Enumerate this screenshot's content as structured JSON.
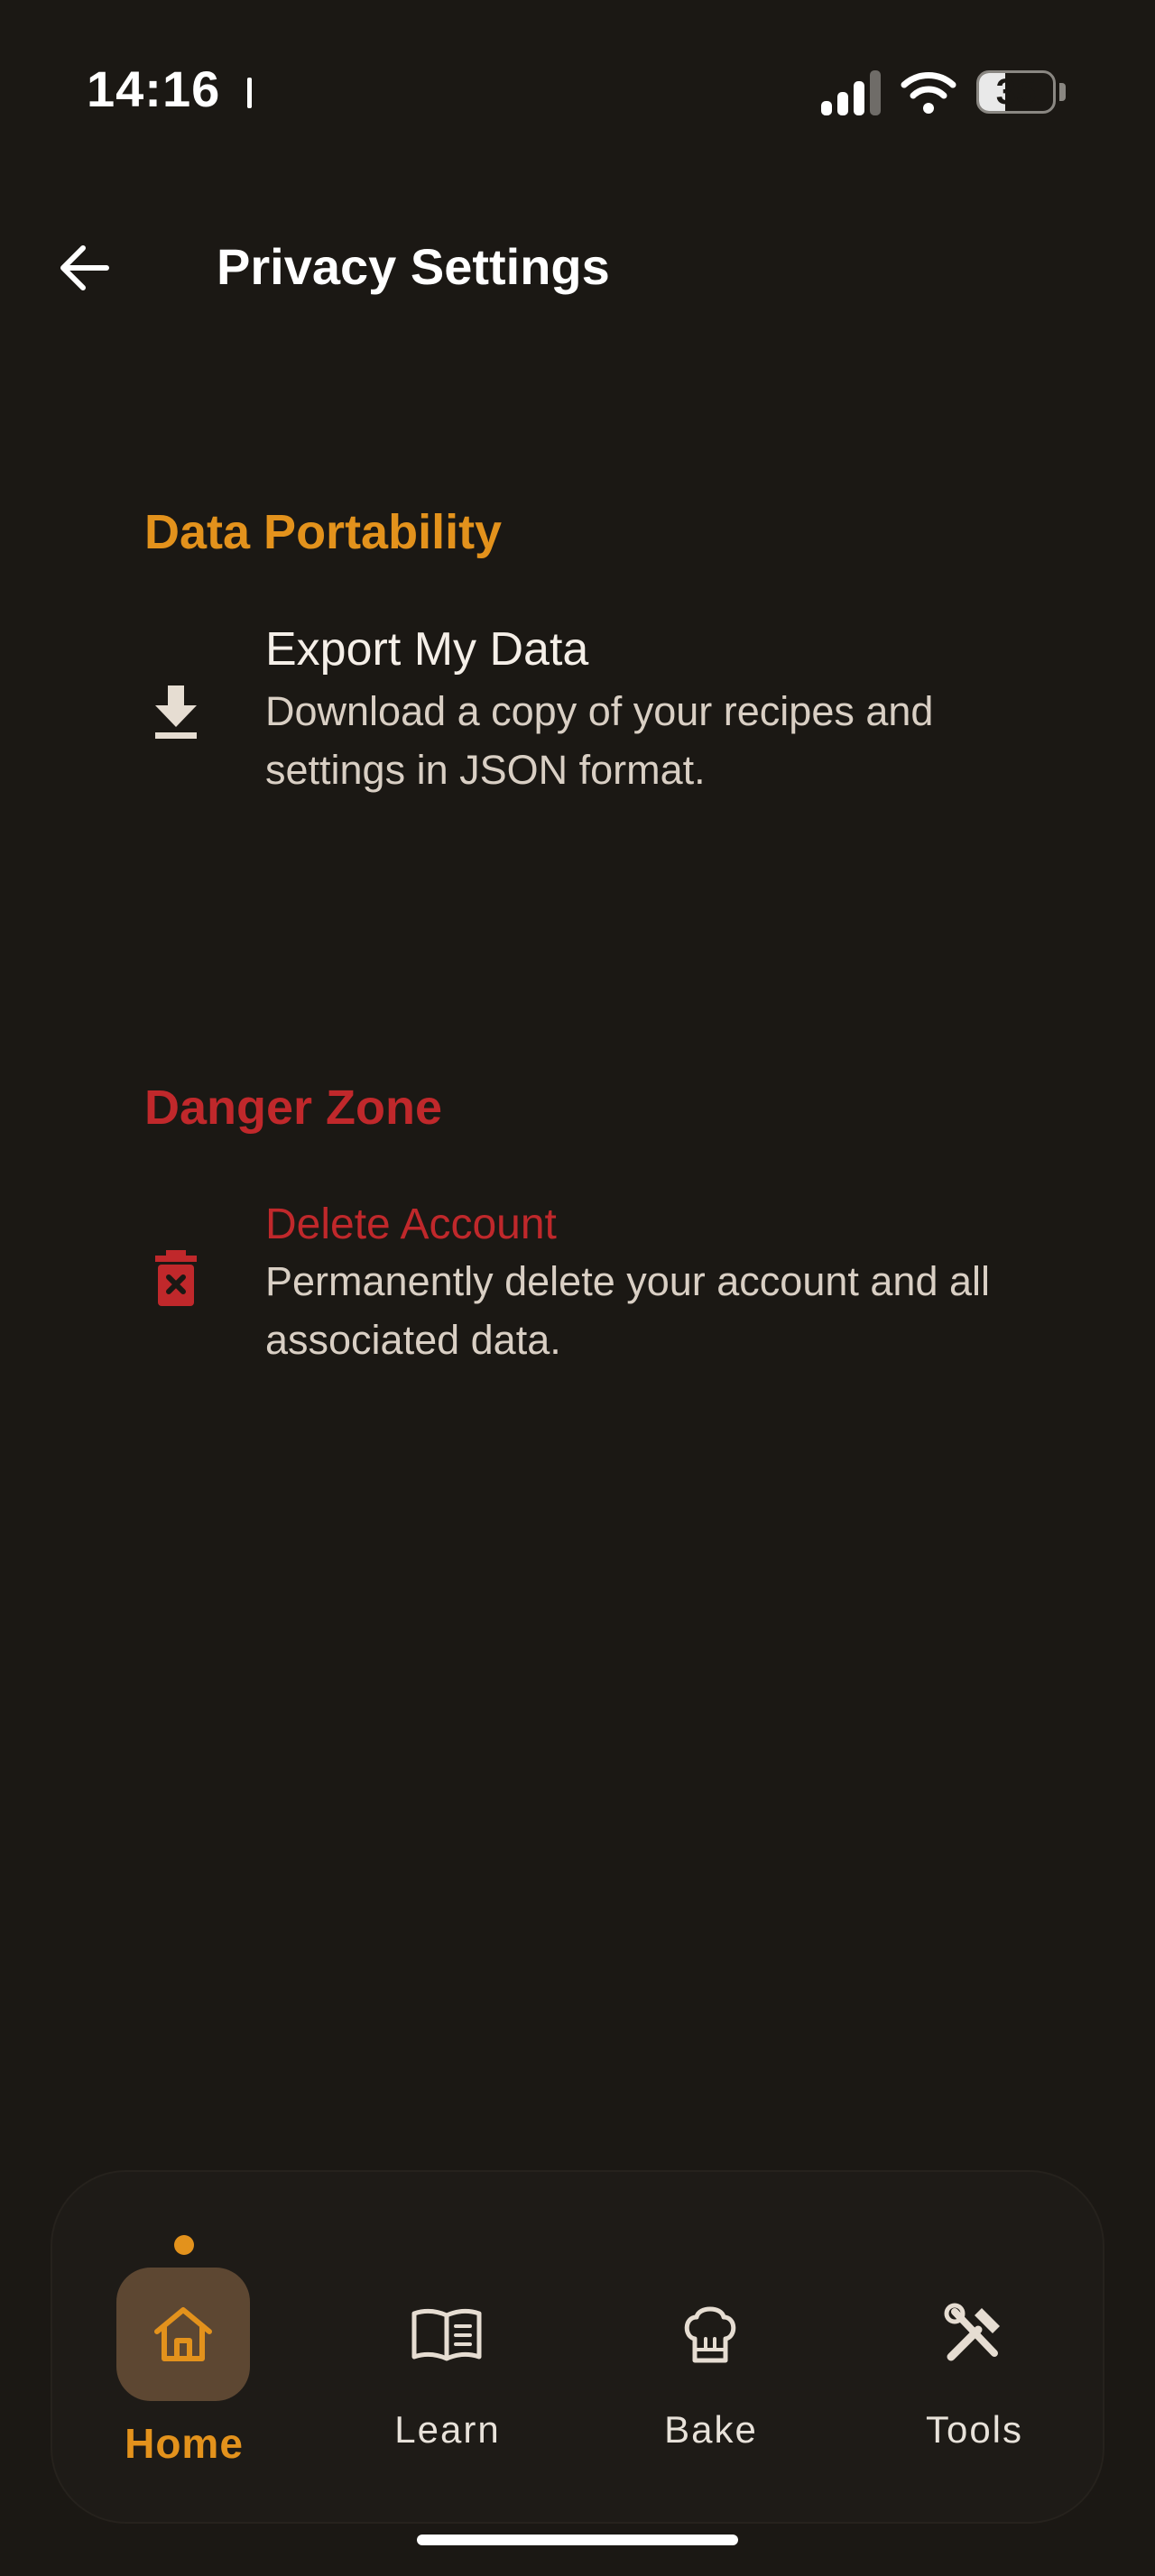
{
  "status_bar": {
    "time": "14:16",
    "battery": "35",
    "battery_level": 0.35
  },
  "header": {
    "title": "Privacy Settings",
    "back_icon": "arrow-left-icon"
  },
  "sections": {
    "data_portability": {
      "title": "Data Portability",
      "export": {
        "title": "Export My Data",
        "description": "Download a copy of your recipes and settings in JSON format.",
        "icon": "download-icon"
      }
    },
    "danger_zone": {
      "title": "Danger Zone",
      "delete": {
        "title": "Delete Account",
        "description": "Permanently delete your account and all associated data.",
        "icon": "trash-icon"
      }
    }
  },
  "bottom_nav": {
    "items": [
      {
        "label": "Home",
        "icon": "home-icon",
        "active": true
      },
      {
        "label": "Learn",
        "icon": "book-icon",
        "active": false
      },
      {
        "label": "Bake",
        "icon": "chef-hat-icon",
        "active": false
      },
      {
        "label": "Tools",
        "icon": "tools-icon",
        "active": false
      }
    ]
  },
  "colors": {
    "background": "#1b1814",
    "accent": "#e3921c",
    "danger": "#c0282b",
    "text_secondary": "#d9cfc4"
  }
}
